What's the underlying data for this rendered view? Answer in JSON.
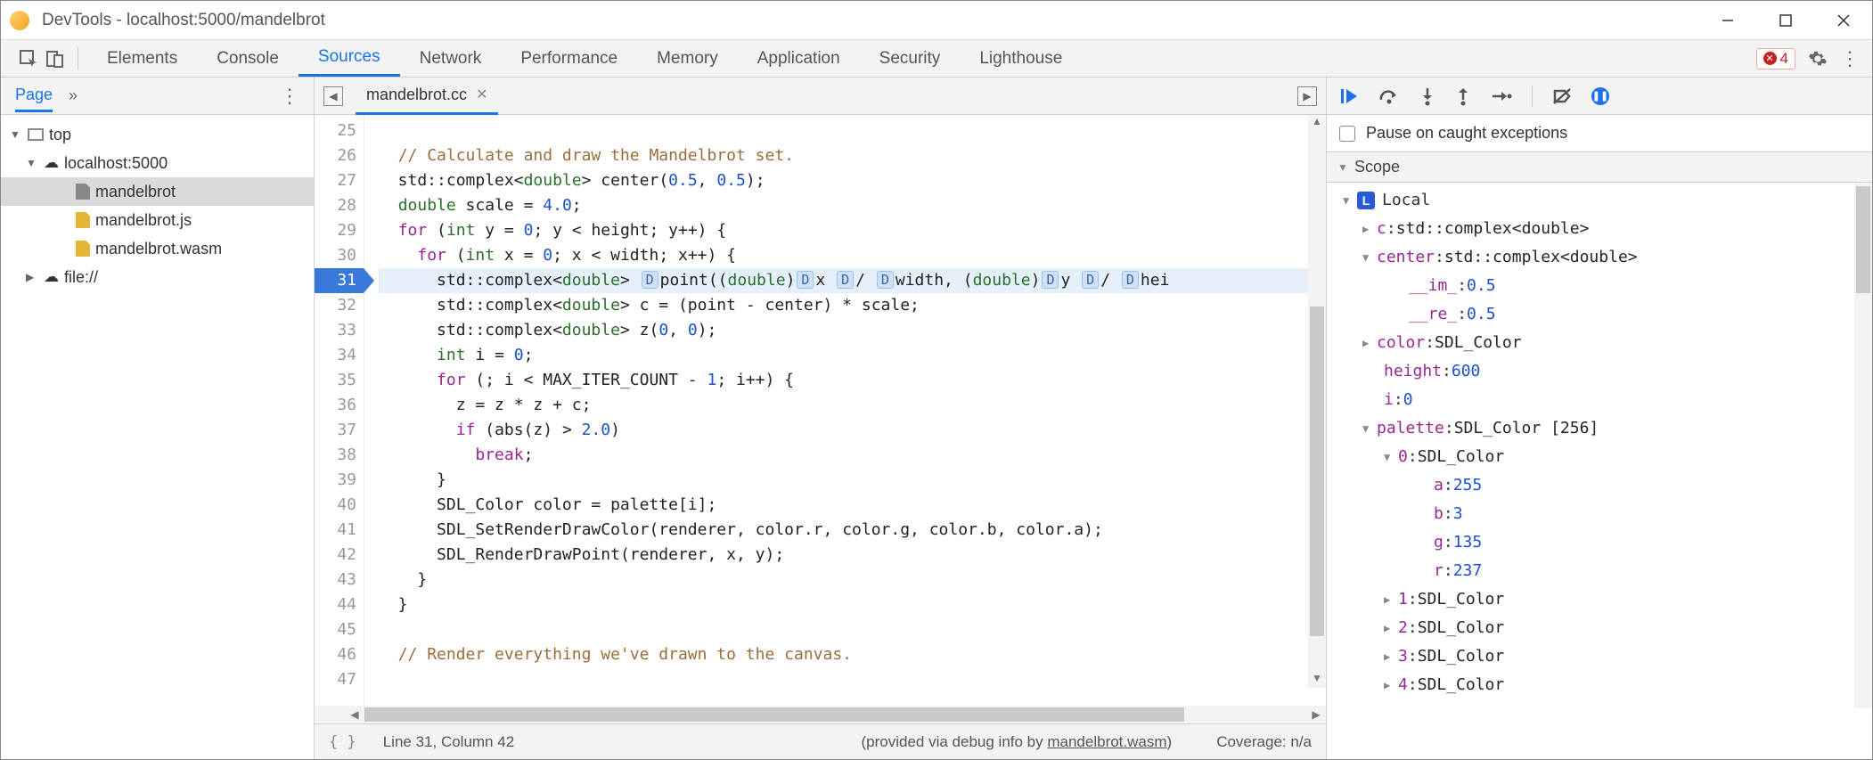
{
  "window": {
    "title": "DevTools - localhost:5000/mandelbrot"
  },
  "tabs": {
    "items": [
      "Elements",
      "Console",
      "Sources",
      "Network",
      "Performance",
      "Memory",
      "Application",
      "Security",
      "Lighthouse"
    ],
    "active": "Sources",
    "error_count": "4"
  },
  "sidebar": {
    "title": "Page",
    "tree": {
      "top": "top",
      "host": "localhost:5000",
      "files": [
        "mandelbrot",
        "mandelbrot.js",
        "mandelbrot.wasm"
      ],
      "file_scheme": "file://"
    }
  },
  "editor": {
    "tab_name": "mandelbrot.cc",
    "first_line_no": 25,
    "current_line_no": 31,
    "lines": [
      {
        "n": 25,
        "html": ""
      },
      {
        "n": 26,
        "html": "  <span class='c-cm'>// Calculate and draw the Mandelbrot set.</span>"
      },
      {
        "n": 27,
        "html": "  std::complex&lt;<span class='c-ty'>double</span>&gt; <span class='c-fn'>center</span>(<span class='c-nm'>0.5</span>, <span class='c-nm'>0.5</span>);"
      },
      {
        "n": 28,
        "html": "  <span class='c-ty'>double</span> scale = <span class='c-nm'>4.0</span>;"
      },
      {
        "n": 29,
        "html": "  <span class='c-kw'>for</span> (<span class='c-ty'>int</span> y = <span class='c-nm'>0</span>; y &lt; height; y++) {"
      },
      {
        "n": 30,
        "html": "    <span class='c-kw'>for</span> (<span class='c-ty'>int</span> x = <span class='c-nm'>0</span>; x &lt; width; x++) {"
      },
      {
        "n": 31,
        "hl": true,
        "html": "      std::complex&lt;<span class='c-ty'>double</span>&gt; <span class='dbg-chip'>D</span><span class='c-fn'>point</span>((<span class='c-ty'>double</span>)<span class='dbg-chip'>D</span>x <span class='dbg-chip'>D</span>/ <span class='dbg-chip'>D</span>width, (<span class='c-ty'>double</span>)<span class='dbg-chip'>D</span>y <span class='dbg-chip'>D</span>/ <span class='dbg-chip'>D</span>hei"
      },
      {
        "n": 32,
        "html": "      std::complex&lt;<span class='c-ty'>double</span>&gt; c = (point - center) * scale;"
      },
      {
        "n": 33,
        "html": "      std::complex&lt;<span class='c-ty'>double</span>&gt; <span class='c-fn'>z</span>(<span class='c-nm'>0</span>, <span class='c-nm'>0</span>);"
      },
      {
        "n": 34,
        "html": "      <span class='c-ty'>int</span> i = <span class='c-nm'>0</span>;"
      },
      {
        "n": 35,
        "html": "      <span class='c-kw'>for</span> (; i &lt; MAX_ITER_COUNT - <span class='c-nm'>1</span>; i++) {"
      },
      {
        "n": 36,
        "html": "        z = z * z + c;"
      },
      {
        "n": 37,
        "html": "        <span class='c-kw'>if</span> (<span class='c-fn'>abs</span>(z) &gt; <span class='c-nm'>2.0</span>)"
      },
      {
        "n": 38,
        "html": "          <span class='c-kw'>break</span>;"
      },
      {
        "n": 39,
        "html": "      }"
      },
      {
        "n": 40,
        "html": "      SDL_Color color = palette[i];"
      },
      {
        "n": 41,
        "html": "      <span class='c-fn'>SDL_SetRenderDrawColor</span>(renderer, color.r, color.g, color.b, color.a);"
      },
      {
        "n": 42,
        "html": "      <span class='c-fn'>SDL_RenderDrawPoint</span>(renderer, x, y);"
      },
      {
        "n": 43,
        "html": "    }"
      },
      {
        "n": 44,
        "html": "  }"
      },
      {
        "n": 45,
        "html": ""
      },
      {
        "n": 46,
        "html": "  <span class='c-cm'>// Render everything we've drawn to the canvas.</span>"
      },
      {
        "n": 47,
        "html": ""
      }
    ]
  },
  "status": {
    "pos": "Line 31, Column 42",
    "provided_prefix": "(provided via debug info by ",
    "provided_link": "mandelbrot.wasm",
    "provided_suffix": ")",
    "coverage": "Coverage: n/a"
  },
  "debugger": {
    "pause_opt": "Pause on caught exceptions",
    "scope_label": "Scope",
    "local_label": "Local",
    "vars": {
      "c": "std::complex<double>",
      "center": "std::complex<double>",
      "center_im": "0.5",
      "center_re": "0.5",
      "color": "SDL_Color",
      "height_k": "height",
      "height_v": "600",
      "i_k": "i",
      "i_v": "0",
      "palette": "SDL_Color [256]",
      "p0": "SDL_Color",
      "p0_a": "255",
      "p0_b": "3",
      "p0_g": "135",
      "p0_r": "237",
      "p1": "SDL_Color",
      "p2": "SDL_Color",
      "p3": "SDL_Color",
      "p4": "SDL_Color"
    }
  }
}
